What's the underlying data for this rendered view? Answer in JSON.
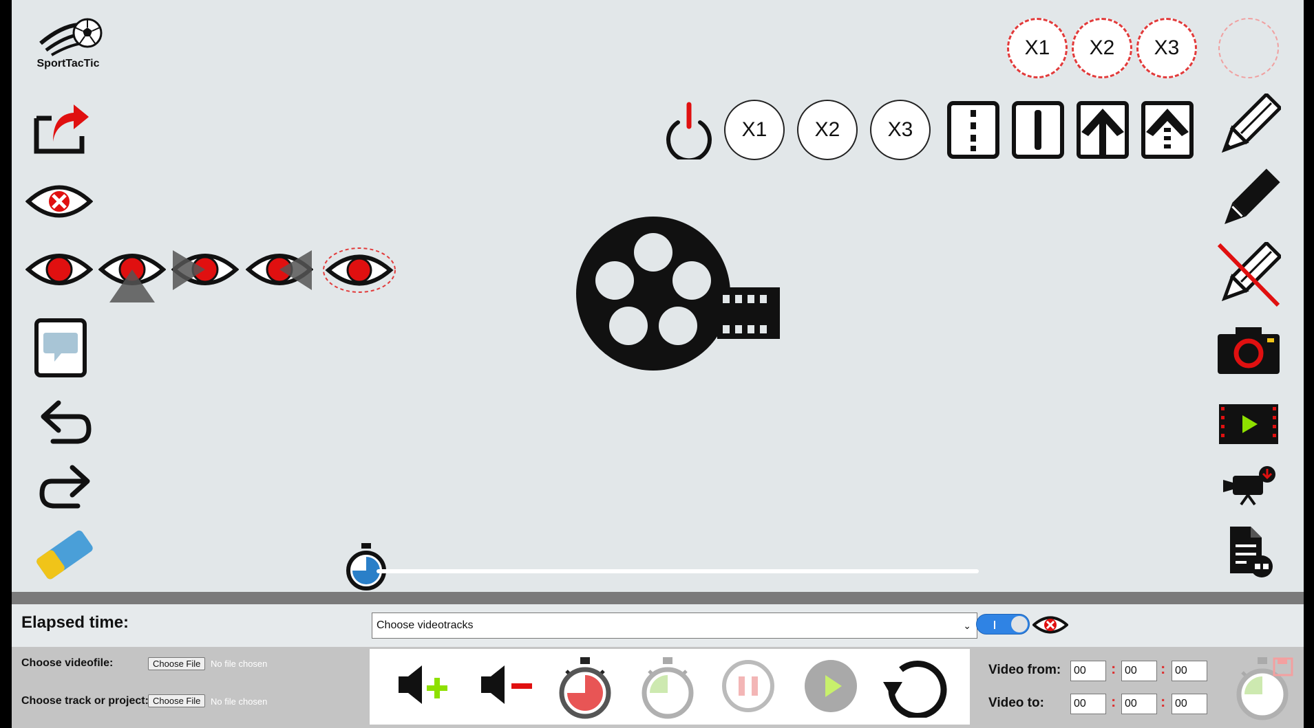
{
  "app": {
    "brand": "SportTacTic"
  },
  "top_speed_buttons": [
    "X1",
    "X2",
    "X3"
  ],
  "toolbar_speed_buttons": [
    "X1",
    "X2",
    "X3"
  ],
  "elapsed_label": "Elapsed time:",
  "videotracks_select": {
    "selected": "Choose videotracks"
  },
  "file_inputs": {
    "videofile_label": "Choose videofile:",
    "track_label": "Choose track or project:",
    "button_label": "Choose File",
    "status": "No file chosen"
  },
  "video_range": {
    "from_label": "Video from:",
    "to_label": "Video to:",
    "from": [
      "00",
      "00",
      "00"
    ],
    "to": [
      "00",
      "00",
      "00"
    ],
    "separator": ":"
  },
  "colors": {
    "background": "#e2e7e9",
    "accent_red": "#e01010",
    "toggle_blue": "#2f83e4",
    "bottom_panel": "#c4c4c4"
  }
}
